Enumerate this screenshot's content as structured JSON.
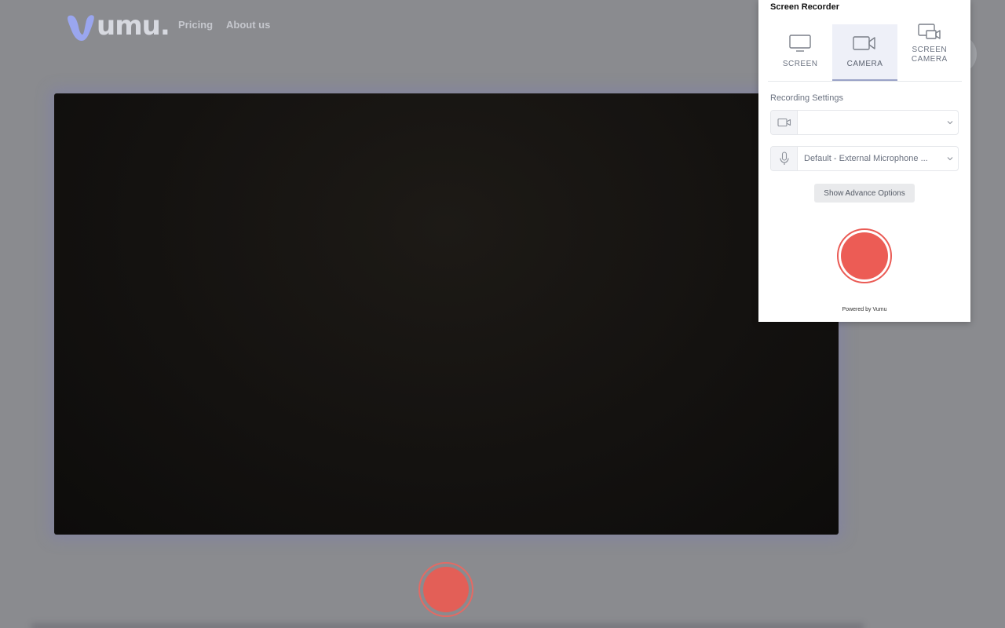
{
  "page": {
    "logo_text": "umu.",
    "nav": {
      "pricing": "Pricing",
      "about": "About us"
    }
  },
  "recorder": {
    "title": "Screen Recorder",
    "modes": [
      {
        "label": "SCREEN",
        "icon": "monitor-icon",
        "active": false
      },
      {
        "label": "CAMERA",
        "icon": "video-camera-icon",
        "active": true
      },
      {
        "label": "SCREEN\nCAMERA",
        "icon": "screen-camera-icon",
        "active": false
      }
    ],
    "settings_heading": "Recording Settings",
    "camera_select": {
      "value": "",
      "icon": "video-camera-icon"
    },
    "mic_select": {
      "value": "Default - External Microphone ...",
      "icon": "microphone-icon"
    },
    "advance_options_label": "Show Advance Options",
    "powered_by": "Powered by Vumu"
  },
  "colors": {
    "record_red": "#ec5c55",
    "overlay_gray": "#8a8b8f",
    "active_tab_bg": "#eef0f8"
  }
}
